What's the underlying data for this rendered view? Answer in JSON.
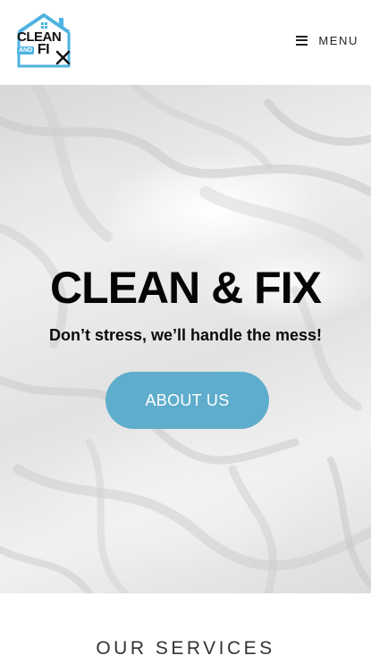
{
  "header": {
    "logo": {
      "line1": "CLEAN",
      "and": "AND",
      "line2": "FI",
      "accent_color": "#4db3e0"
    },
    "menu_label": "MENU",
    "menu_icon": "hamburger-icon"
  },
  "hero": {
    "title": "CLEAN & FIX",
    "subtitle": "Don’t stress, we’ll handle the mess!",
    "button_label": "ABOUT US",
    "button_color": "#5fadcc",
    "background": "white-bedsheets-photo"
  },
  "services": {
    "title": "OUR SERVICES"
  }
}
